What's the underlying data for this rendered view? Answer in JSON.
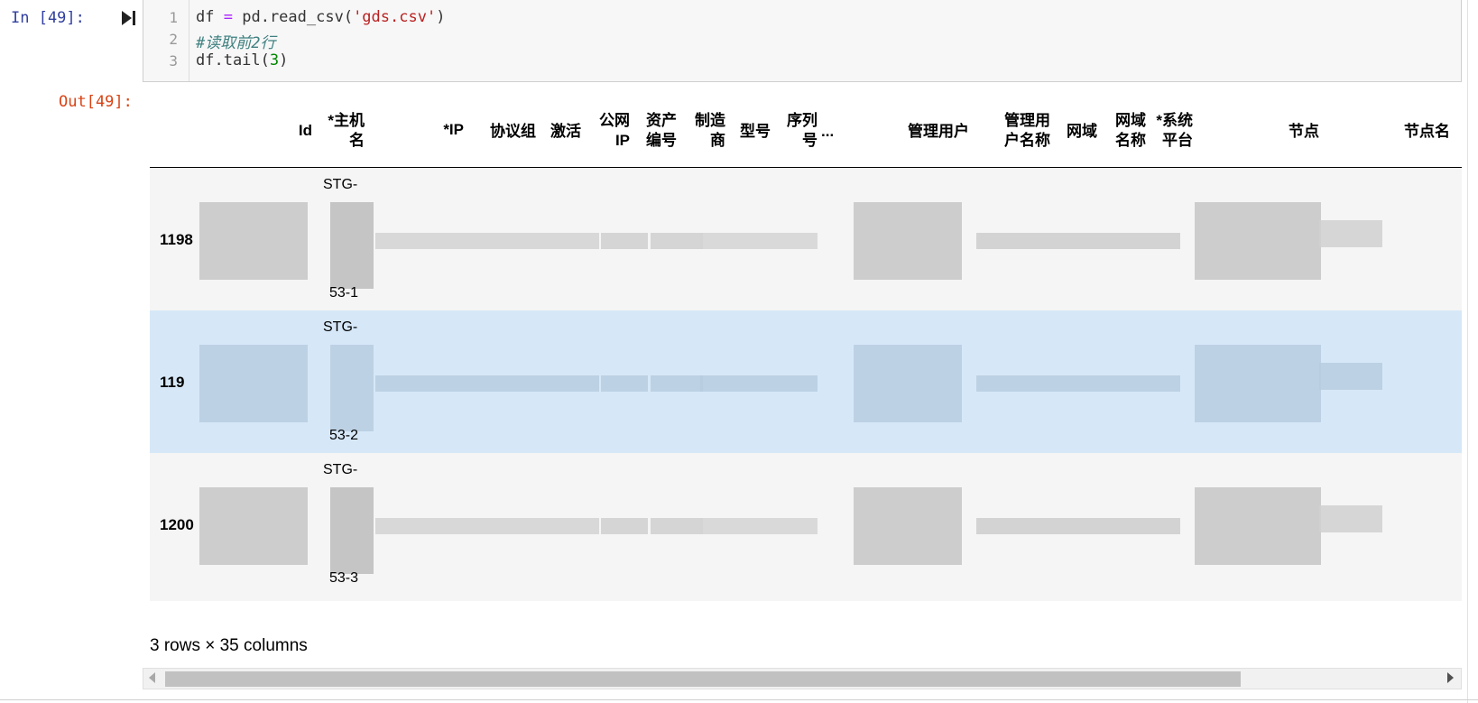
{
  "in_prompt": "In [49]:",
  "out_prompt": "Out[49]:",
  "code": {
    "line_numbers": [
      "1",
      "2",
      "3"
    ],
    "line1": {
      "var": "df",
      "op": "=",
      "call": "pd.read_csv(",
      "str": "'gds.csv'",
      "close": ")"
    },
    "line2": {
      "comment": "#读取前2行"
    },
    "line3": {
      "call": "df.tail(",
      "num": "3",
      "close": ")"
    }
  },
  "table": {
    "columns": [
      "Id",
      "*主机名",
      "*IP",
      "协议组",
      "激活",
      "公网IP",
      "资产编号",
      "制造商",
      "型号",
      "序列号",
      "...",
      "管理用户",
      "管理用户名称",
      "网域",
      "网域名称",
      "*系统平台",
      "节点",
      "节点名"
    ],
    "header_lines": {
      "id": "Id",
      "hostname": [
        "*主机",
        "名"
      ],
      "ip": "*IP",
      "protocol_group": "协议组",
      "active": "激活",
      "public_ip": [
        "公网",
        "IP"
      ],
      "asset_no": [
        "资产",
        "编号"
      ],
      "vendor": [
        "制造",
        "商"
      ],
      "model": "型号",
      "serial": [
        "序列",
        "号"
      ],
      "ellipsis": "...",
      "admin_user": "管理用户",
      "admin_user_name": [
        "管理用",
        "户名称"
      ],
      "domain": "网域",
      "domain_name": [
        "网域",
        "名称"
      ],
      "platform": [
        "*系统",
        "平台"
      ],
      "node": "节点",
      "node_name": "节点名"
    },
    "rows": [
      {
        "index": "1198",
        "host_top": "STG-",
        "host_bottom": "53-1",
        "highlighted": false
      },
      {
        "index": "119",
        "host_top": "STG-",
        "host_bottom": "53-2",
        "highlighted": true
      },
      {
        "index": "1200",
        "host_top": "STG-",
        "host_bottom": "53-3",
        "highlighted": false
      }
    ],
    "shape_text": "3 rows × 35 columns"
  },
  "colors": {
    "row_default": "#f5f5f5",
    "row_highlight": "#d6e8f8",
    "in_prompt": "#303f9f",
    "out_prompt": "#d84315"
  }
}
